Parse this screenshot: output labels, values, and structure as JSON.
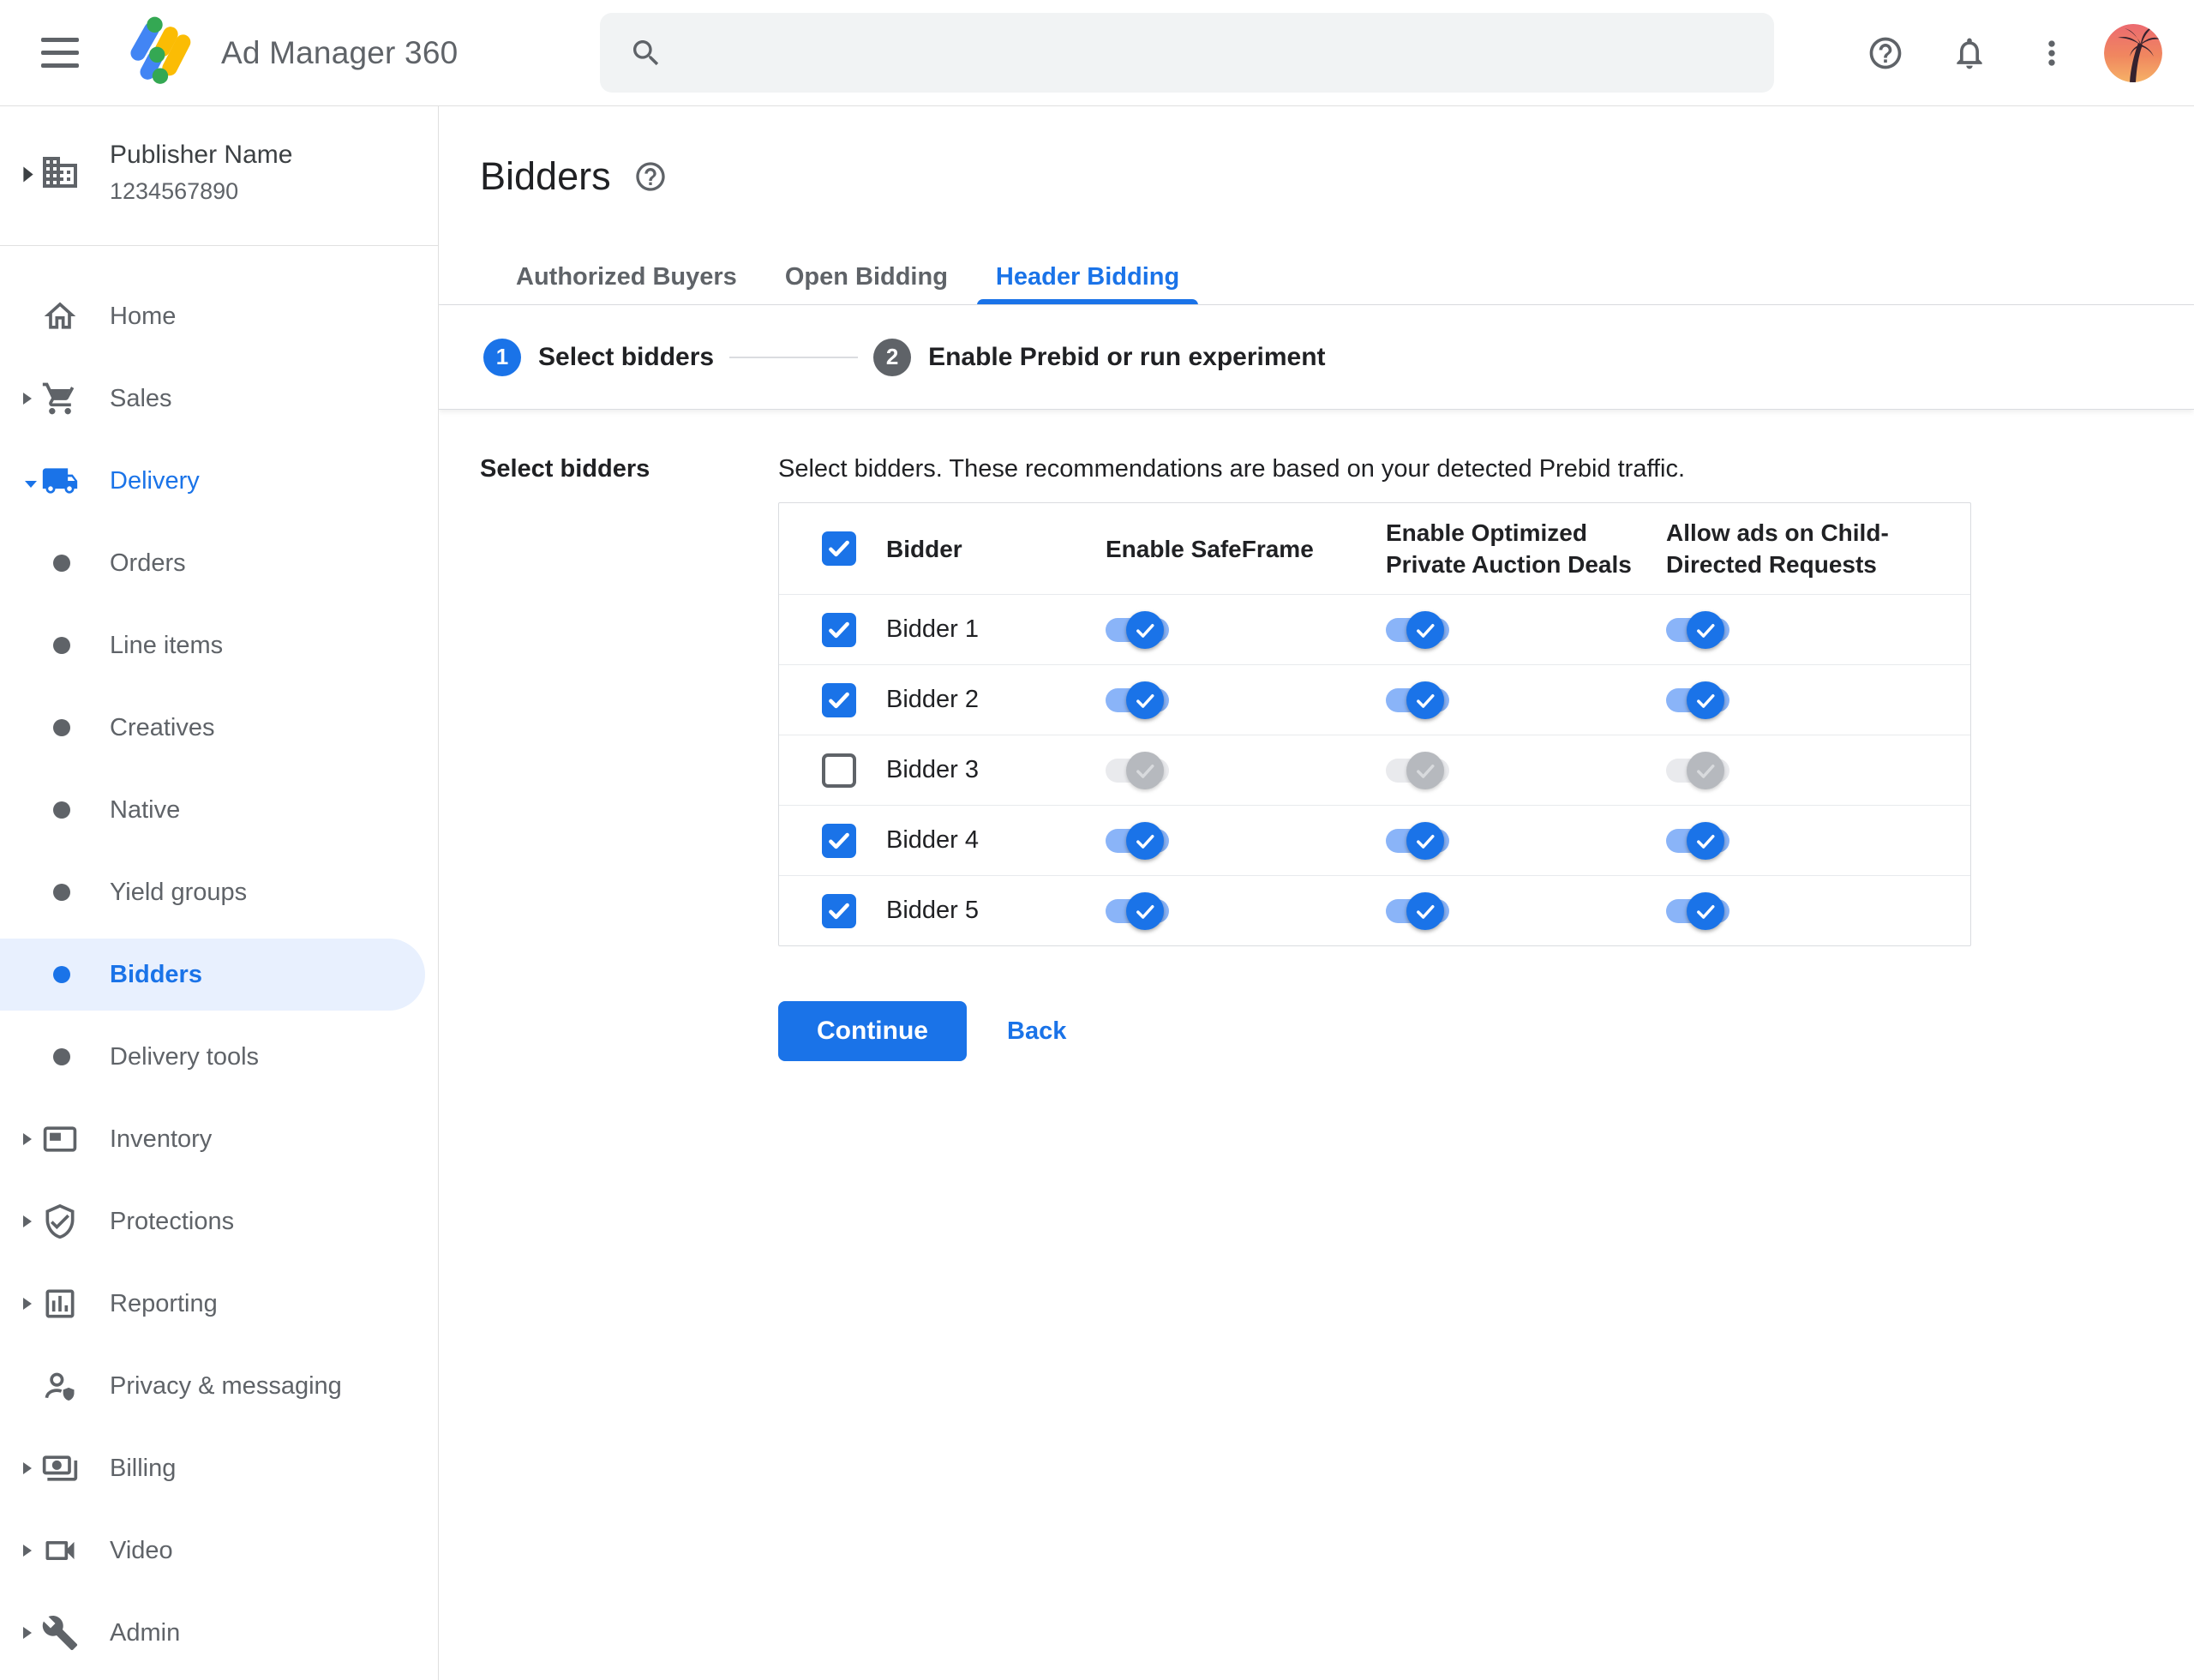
{
  "topbar": {
    "app_name": "Ad Manager 360",
    "search": {
      "placeholder": "",
      "value": ""
    }
  },
  "sidebar": {
    "publisher": {
      "name": "Publisher Name",
      "id": "1234567890"
    },
    "items": [
      {
        "label": "Home",
        "icon": "home",
        "type": "top",
        "arrow": "none"
      },
      {
        "label": "Sales",
        "icon": "cart",
        "type": "top",
        "arrow": "right"
      },
      {
        "label": "Delivery",
        "icon": "truck",
        "type": "top",
        "arrow": "down",
        "expanded": true,
        "blue": true
      },
      {
        "label": "Orders",
        "type": "sub"
      },
      {
        "label": "Line items",
        "type": "sub"
      },
      {
        "label": "Creatives",
        "type": "sub"
      },
      {
        "label": "Native",
        "type": "sub"
      },
      {
        "label": "Yield groups",
        "type": "sub"
      },
      {
        "label": "Bidders",
        "type": "sub",
        "active": true
      },
      {
        "label": "Delivery tools",
        "type": "sub"
      },
      {
        "label": "Inventory",
        "icon": "adunit",
        "type": "top",
        "arrow": "right"
      },
      {
        "label": "Protections",
        "icon": "shield",
        "type": "top",
        "arrow": "right"
      },
      {
        "label": "Reporting",
        "icon": "chart",
        "type": "top",
        "arrow": "right"
      },
      {
        "label": "Privacy & messaging",
        "icon": "privacy",
        "type": "top",
        "arrow": "none"
      },
      {
        "label": "Billing",
        "icon": "billing",
        "type": "top",
        "arrow": "right"
      },
      {
        "label": "Video",
        "icon": "video",
        "type": "top",
        "arrow": "right"
      },
      {
        "label": "Admin",
        "icon": "admin",
        "type": "top",
        "arrow": "right"
      }
    ]
  },
  "page": {
    "title": "Bidders",
    "tabs": [
      {
        "label": "Authorized Buyers",
        "active": false
      },
      {
        "label": "Open Bidding",
        "active": false
      },
      {
        "label": "Header Bidding",
        "active": true
      }
    ],
    "stepper": [
      {
        "number": "1",
        "label": "Select bidders",
        "state": "current"
      },
      {
        "number": "2",
        "label": "Enable Prebid or run experiment",
        "state": "upcoming"
      }
    ]
  },
  "content": {
    "section_label": "Select bidders",
    "description": "Select bidders. These recommendations are based on your detected Prebid traffic.",
    "table": {
      "select_all_checked": true,
      "columns": [
        "Bidder",
        "Enable SafeFrame",
        "Enable Optimized Private Auction Deals",
        "Allow ads on Child-Directed Requests"
      ],
      "rows": [
        {
          "label": "Bidder 1",
          "checked": true,
          "safeframe": true,
          "optimized_private_auction": true,
          "child_directed": true
        },
        {
          "label": "Bidder 2",
          "checked": true,
          "safeframe": true,
          "optimized_private_auction": true,
          "child_directed": true
        },
        {
          "label": "Bidder 3",
          "checked": false,
          "safeframe": false,
          "optimized_private_auction": false,
          "child_directed": false
        },
        {
          "label": "Bidder 4",
          "checked": true,
          "safeframe": true,
          "optimized_private_auction": true,
          "child_directed": true
        },
        {
          "label": "Bidder 5",
          "checked": true,
          "safeframe": true,
          "optimized_private_auction": true,
          "child_directed": true
        }
      ]
    },
    "continue_label": "Continue",
    "back_label": "Back"
  },
  "colors": {
    "accent": "#1a73e8",
    "accent_track": "#8ab4f8",
    "selected_item_bg": "#e8f0fe",
    "text_primary": "#202124",
    "text_secondary": "#5f6368",
    "border": "#dadce0",
    "search_bg": "#f1f3f4",
    "toggle_off_track": "#e9eaed",
    "toggle_off_thumb": "#b6b9be",
    "logo_blue": "#4285f4",
    "logo_yellow": "#fbbc04",
    "logo_green": "#34a853"
  }
}
